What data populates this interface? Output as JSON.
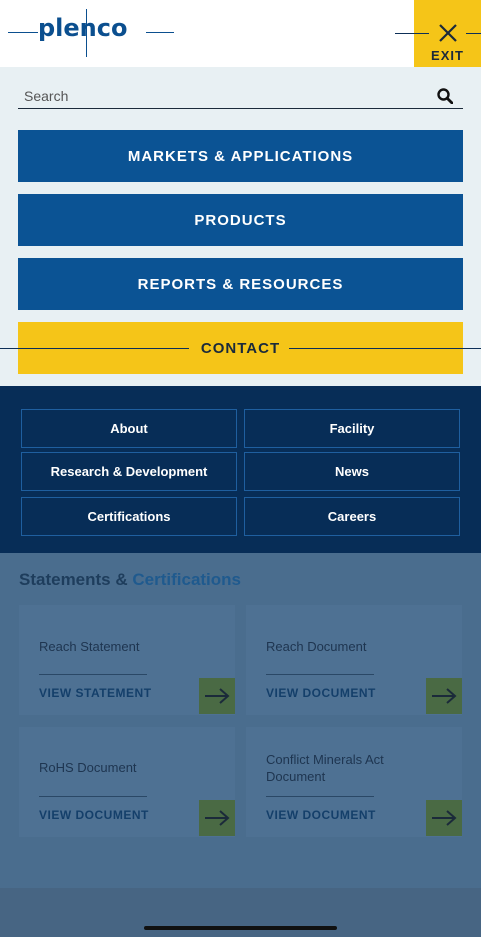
{
  "header": {
    "logo_text": "plenco",
    "exit_label": "EXIT",
    "brand_colors": {
      "blue": "#0b5394",
      "yellow": "#f5c518",
      "navy": "#072d57"
    }
  },
  "menu": {
    "search_placeholder": "Search",
    "primary_items": [
      {
        "label": "MARKETS & APPLICATIONS"
      },
      {
        "label": "PRODUCTS"
      },
      {
        "label": "REPORTS & RESOURCES"
      },
      {
        "label": "CONTACT"
      }
    ],
    "secondary_items": [
      {
        "label": "About"
      },
      {
        "label": "Facility"
      },
      {
        "label": "Research & Development"
      },
      {
        "label": "News"
      },
      {
        "label": "Certifications"
      },
      {
        "label": "Careers"
      }
    ]
  },
  "page": {
    "section_title_part1": "Statements &",
    "section_title_part2": "Certifications",
    "cards": [
      {
        "title": "Reach Statement",
        "link": "VIEW STATEMENT",
        "icon": "arrow-right-icon"
      },
      {
        "title": "Reach Document",
        "link": "VIEW DOCUMENT",
        "icon": "arrow-right-icon"
      },
      {
        "title": "RoHS Document",
        "link": "VIEW DOCUMENT",
        "icon": "arrow-right-icon"
      },
      {
        "title": "Conflict Minerals Act Document",
        "link": "VIEW DOCUMENT",
        "icon": "arrow-right-icon"
      }
    ]
  }
}
